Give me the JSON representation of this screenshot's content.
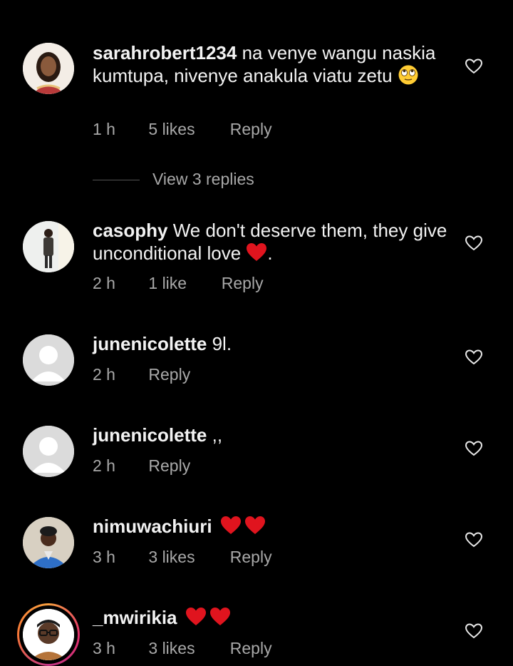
{
  "comments": [
    {
      "username": "sarahrobert1234",
      "text": "na venye wangu naskia kumtupa, nivenye anakula viatu zetu",
      "time": "1 h",
      "likes": "5 likes",
      "reply": "Reply"
    },
    {
      "username": "casophy",
      "text": "We don't deserve them, they give unconditional love",
      "text_suffix": ".",
      "time": "2 h",
      "likes": "1 like",
      "reply": "Reply"
    },
    {
      "username": "junenicolette",
      "text": "9l.",
      "time": "2 h",
      "reply": "Reply"
    },
    {
      "username": "junenicolette",
      "text": ",,",
      "time": "2 h",
      "reply": "Reply"
    },
    {
      "username": "nimuwachiuri",
      "text": "",
      "time": "3 h",
      "likes": "3 likes",
      "reply": "Reply"
    },
    {
      "username": "_mwirikia",
      "text": "",
      "time": "3 h",
      "likes": "3 likes",
      "reply": "Reply"
    }
  ],
  "view_replies": "View 3 replies",
  "colors": {
    "background": "#000000",
    "text": "#f2f2f2",
    "meta": "#a8a8a8",
    "heart_emoji": "#e0141e"
  }
}
